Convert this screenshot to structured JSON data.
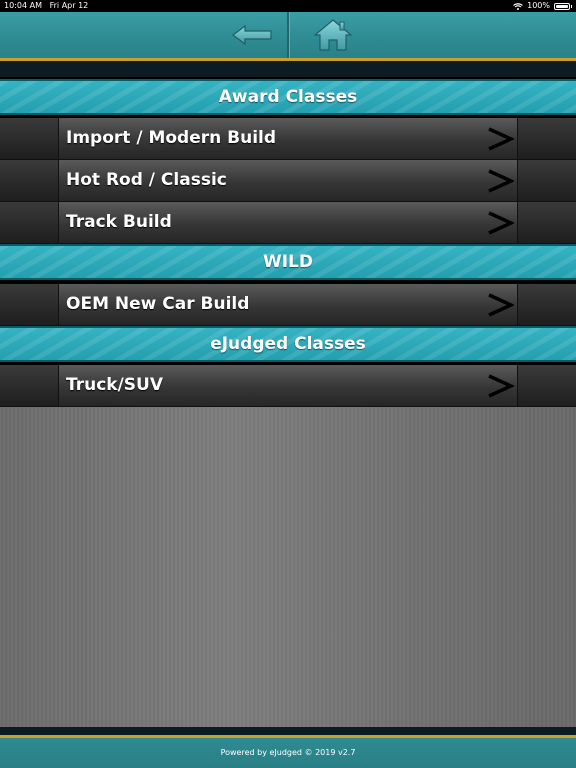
{
  "status_bar": {
    "time": "10:04 AM",
    "date": "Fri Apr 12",
    "battery": "100%"
  },
  "header": {
    "back_icon": "arrow-left-icon",
    "home_icon": "home-icon"
  },
  "sections": [
    {
      "title": "Award Classes",
      "items": [
        "Import / Modern Build",
        "Hot Rod / Classic",
        "Track Build"
      ]
    },
    {
      "title": "WILD",
      "items": [
        "OEM New Car Build"
      ]
    },
    {
      "title": "eJudged Classes",
      "items": [
        "Truck/SUV"
      ]
    }
  ],
  "footer": {
    "text": "Powered by eJudged © 2019 v2.7"
  },
  "colors": {
    "accent": "#c8a12a",
    "teal": "#2e8b92",
    "section": "#2aa8b8"
  }
}
